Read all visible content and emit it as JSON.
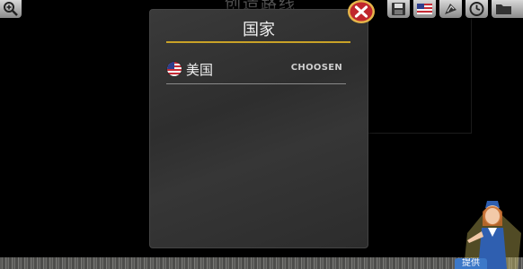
{
  "background": {
    "title": "创造路线"
  },
  "dialog": {
    "title": "国家",
    "countries": [
      {
        "name": "美国",
        "status": "CHOOSEN",
        "flag_icon": "us-flag-icon"
      }
    ]
  },
  "toolbar": {
    "icons": [
      "zoom-icon",
      "save-icon",
      "us-flag-icon",
      "route-icon",
      "clock-icon",
      "folder-icon"
    ]
  },
  "mascot": {
    "label": "提供"
  },
  "colors": {
    "title_underline": "#c9a227",
    "close_button": "#c0262d",
    "dialog_bg": "#333333"
  }
}
